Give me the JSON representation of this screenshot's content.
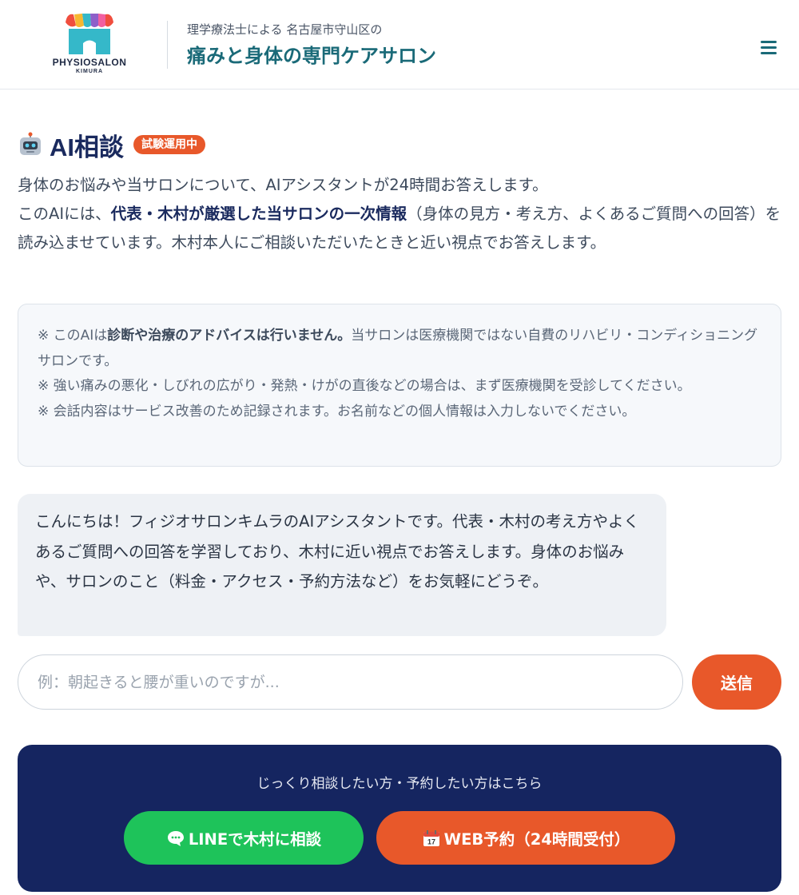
{
  "header": {
    "logo_text": "PHYSIOSALON",
    "logo_sub": "KIMURA",
    "tagline": "理学療法士による 名古屋市守山区の",
    "title": "痛みと身体の専門ケアサロン",
    "menu_icon": "hamburger-menu-icon",
    "brand_color": "#1a6a78"
  },
  "ai_section": {
    "icon": "robot-icon",
    "title": "AI相談",
    "badge": "試験運用中",
    "intro_line1": "身体のお悩みや当サロンについて、AIアシスタントが24時間お答えします。",
    "intro_line2_before": "このAIには、",
    "intro_line2_bold": "代表・木村が厳選した当サロンの一次情報",
    "intro_line2_after": "（身体の見方・考え方、よくあるご質問への回答）を読み込ませています。木村本人にご相談いただいたときと近い視点でお答えします。"
  },
  "notice": {
    "item1_prefix": "※ このAIは",
    "item1_bold": "診断や治療のアドバイスは行いません。",
    "item1_rest": "当サロンは医療機関ではない自費のリハビリ・コンディショニングサロンです。",
    "item2": "※ 強い痛みの悪化・しびれの広がり・発熱・けがの直後などの場合は、まず医療機関を受診してください。",
    "item3": "※ 会話内容はサービス改善のため記録されます。お名前などの個人情報は入力しないでください。"
  },
  "chat": {
    "assistant_message": "こんにちは！フィジオサロンキムラのAIアシスタントです。代表・木村の考え方やよくあるご質問への回答を学習しており、木村に近い視点でお答えします。身体のお悩みや、サロンのこと（料金・アクセス・予約方法など）をお気軽にどうぞ。",
    "input_value": "",
    "input_placeholder": "例：朝起きると腰が重いのですが...",
    "send_label": "送信"
  },
  "cta": {
    "text": "じっくり相談したい方・予約したい方はこちら",
    "line_icon": "speech-bubble-icon",
    "line_label": "LINEで木村に相談",
    "web_icon": "calendar-icon",
    "web_label": "WEB予約（24時間受付）",
    "colors": {
      "panel": "#152560",
      "line": "#1ec35a",
      "accent": "#e8582a"
    }
  }
}
